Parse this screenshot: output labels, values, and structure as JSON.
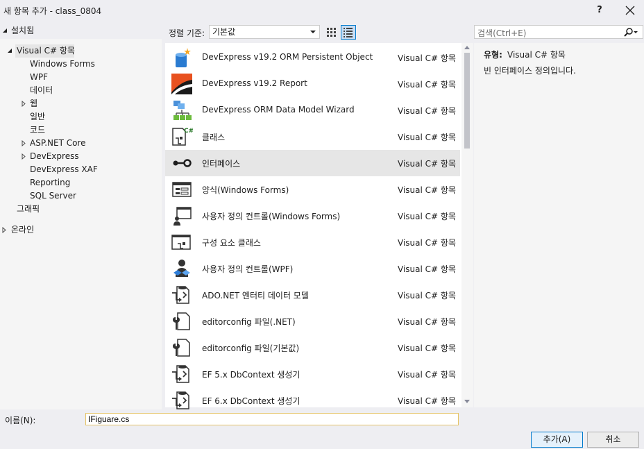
{
  "window": {
    "title": "새 항목 추가 - class_0804",
    "help_label": "?"
  },
  "tree": {
    "installed_label": "설치됨",
    "root_label": "Visual C# 항목",
    "children": [
      "Windows Forms",
      "WPF",
      "데이터",
      "웹",
      "일반",
      "코드",
      "ASP.NET Core",
      "DevExpress",
      "DevExpress XAF",
      "Reporting",
      "SQL Server"
    ],
    "graphics_label": "그래픽",
    "online_label": "온라인"
  },
  "sort": {
    "label": "정렬 기준:",
    "value": "기본값"
  },
  "search": {
    "placeholder": "검색(Ctrl+E)"
  },
  "items": [
    {
      "name": "DevExpress v19.2 ORM Persistent Object",
      "category": "Visual C# 항목",
      "icon": "devexpress-orm-icon"
    },
    {
      "name": "DevExpress v19.2 Report",
      "category": "Visual C# 항목",
      "icon": "devexpress-report-icon"
    },
    {
      "name": "DevExpress ORM Data Model Wizard",
      "category": "Visual C# 항목",
      "icon": "data-model-wizard-icon"
    },
    {
      "name": "클래스",
      "category": "Visual C# 항목",
      "icon": "class-icon"
    },
    {
      "name": "인터페이스",
      "category": "Visual C# 항목",
      "icon": "interface-icon"
    },
    {
      "name": "양식(Windows Forms)",
      "category": "Visual C# 항목",
      "icon": "form-icon"
    },
    {
      "name": "사용자 정의 컨트롤(Windows Forms)",
      "category": "Visual C# 항목",
      "icon": "user-control-icon"
    },
    {
      "name": "구성 요소 클래스",
      "category": "Visual C# 항목",
      "icon": "component-class-icon"
    },
    {
      "name": "사용자 정의 컨트롤(WPF)",
      "category": "Visual C# 항목",
      "icon": "wpf-user-control-icon"
    },
    {
      "name": "ADO.NET 엔터티 데이터 모델",
      "category": "Visual C# 항목",
      "icon": "ado-entity-model-icon"
    },
    {
      "name": "editorconfig 파일(.NET)",
      "category": "Visual C# 항목",
      "icon": "editorconfig-file-icon"
    },
    {
      "name": "editorconfig 파일(기본값)",
      "category": "Visual C# 항목",
      "icon": "editorconfig-file-icon"
    },
    {
      "name": "EF 5.x DbContext 생성기",
      "category": "Visual C# 항목",
      "icon": "dbcontext-generator-icon"
    },
    {
      "name": "EF 6.x DbContext 생성기",
      "category": "Visual C# 항목",
      "icon": "dbcontext-generator-icon"
    }
  ],
  "selected_item_index": 4,
  "detail": {
    "type_label": "유형:",
    "type_value": "Visual C# 항목",
    "description": "빈 인터페이스 정의입니다."
  },
  "name_field": {
    "label": "이름(N):",
    "value": "IFiguare.cs"
  },
  "buttons": {
    "add_label": "추가(A)",
    "cancel_label": "취소"
  },
  "colors": {
    "accent": "#007acc",
    "selection": "#e6e6e6",
    "input_focus_border": "#e5c365"
  }
}
